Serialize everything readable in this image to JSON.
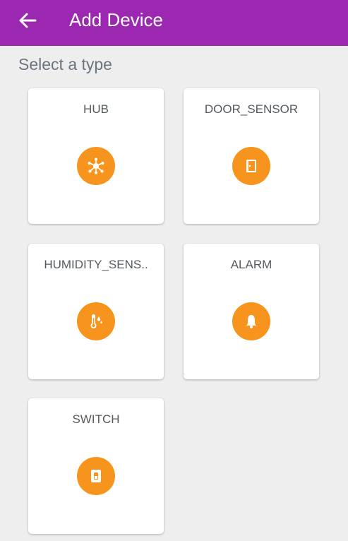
{
  "header": {
    "title": "Add Device",
    "back_icon": "arrow-left-icon",
    "background": "#9c27b0"
  },
  "subtitle": "Select a type",
  "accent_color": "#f7941d",
  "device_types": [
    {
      "label": "HUB",
      "icon": "hub-network-icon"
    },
    {
      "label": "DOOR_SENSOR",
      "icon": "door-icon"
    },
    {
      "label": "HUMIDITY_SENS..",
      "icon": "thermometer-humidity-icon"
    },
    {
      "label": "ALARM",
      "icon": "bell-icon"
    },
    {
      "label": "SWITCH",
      "icon": "light-switch-icon"
    }
  ]
}
